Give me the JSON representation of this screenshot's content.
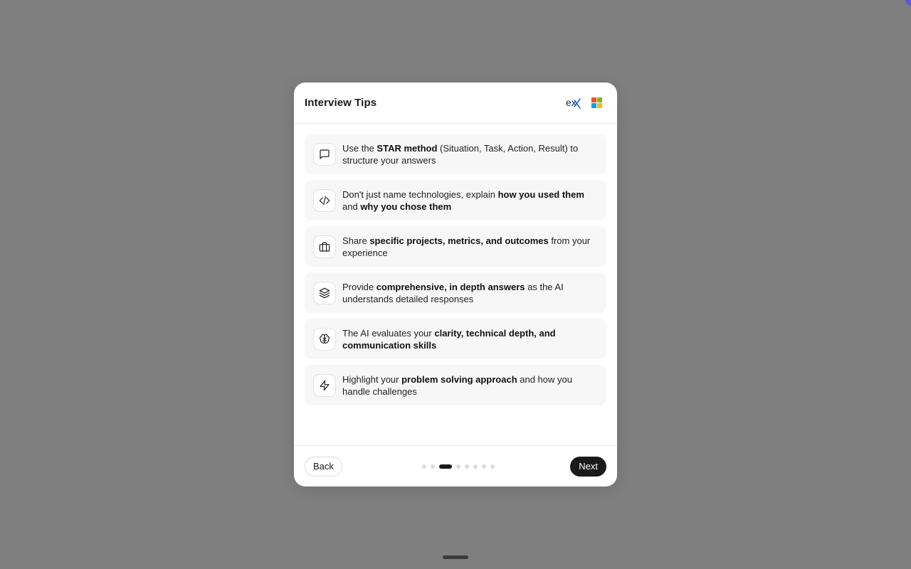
{
  "header": {
    "title": "Interview Tips",
    "logo_ex_text": "ex",
    "brand_colors": {
      "ex_blue": "#2563eb",
      "ms_red": "#f25022",
      "ms_green": "#7fba00",
      "ms_blue": "#00a4ef",
      "ms_yellow": "#ffb900"
    }
  },
  "tips": [
    {
      "icon": "message-square-icon",
      "parts": [
        "Use the ",
        "STAR method",
        " (Situation, Task, Action, Result) to structure your answers"
      ]
    },
    {
      "icon": "code-icon",
      "parts": [
        "Don't just name technologies, explain ",
        "how you used them",
        " and ",
        "why you chose them"
      ]
    },
    {
      "icon": "briefcase-icon",
      "parts": [
        "Share ",
        "specific projects, metrics, and outcomes",
        " from your experience"
      ]
    },
    {
      "icon": "layers-icon",
      "parts": [
        "Provide ",
        "comprehensive, in depth answers",
        " as the AI understands detailed responses"
      ]
    },
    {
      "icon": "brain-icon",
      "parts": [
        "The AI evaluates your ",
        "clarity, technical depth, and communication skills"
      ]
    },
    {
      "icon": "zap-icon",
      "parts": [
        "Highlight your ",
        "problem solving approach",
        " and how you handle challenges"
      ]
    }
  ],
  "footer": {
    "back_label": "Back",
    "next_label": "Next",
    "pagination": {
      "total": 8,
      "current": 3
    }
  }
}
